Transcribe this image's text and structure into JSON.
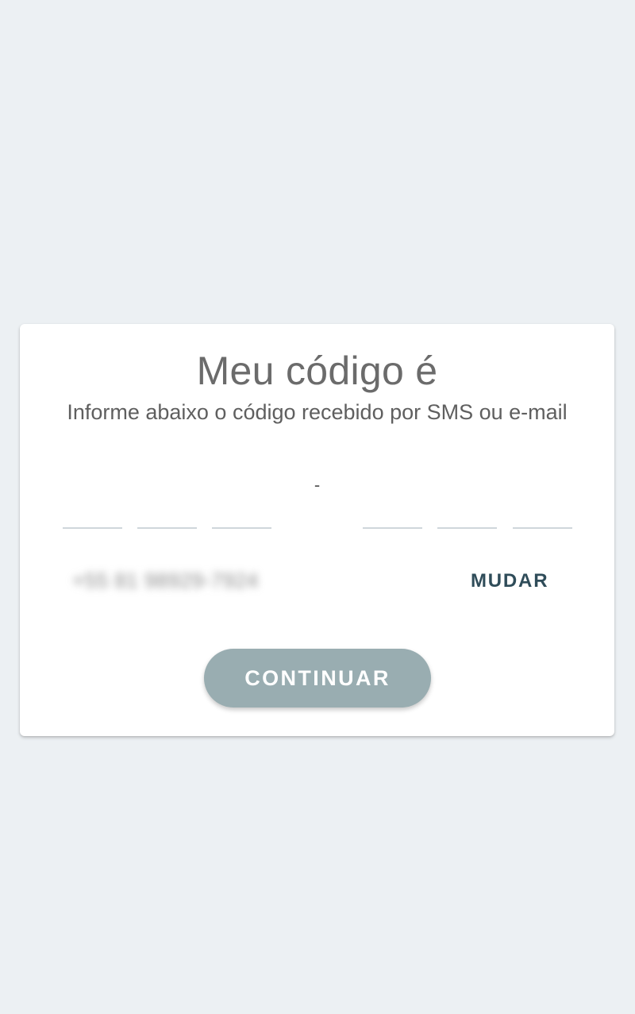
{
  "card": {
    "title": "Meu código é",
    "subtitle": "Informe abaixo o código recebido por SMS ou e-mail",
    "separator": "-",
    "code_digits": [
      "",
      "",
      "",
      "",
      "",
      ""
    ],
    "phone_number": "+55 81 98929-7924",
    "change_label": "MUDAR",
    "continue_label": "CONTINUAR"
  },
  "colors": {
    "background": "#ecf0f3",
    "card": "#ffffff",
    "continue_button": "#99adb1",
    "change_link": "#2f4c59",
    "input_underline": "#cfd6db"
  }
}
